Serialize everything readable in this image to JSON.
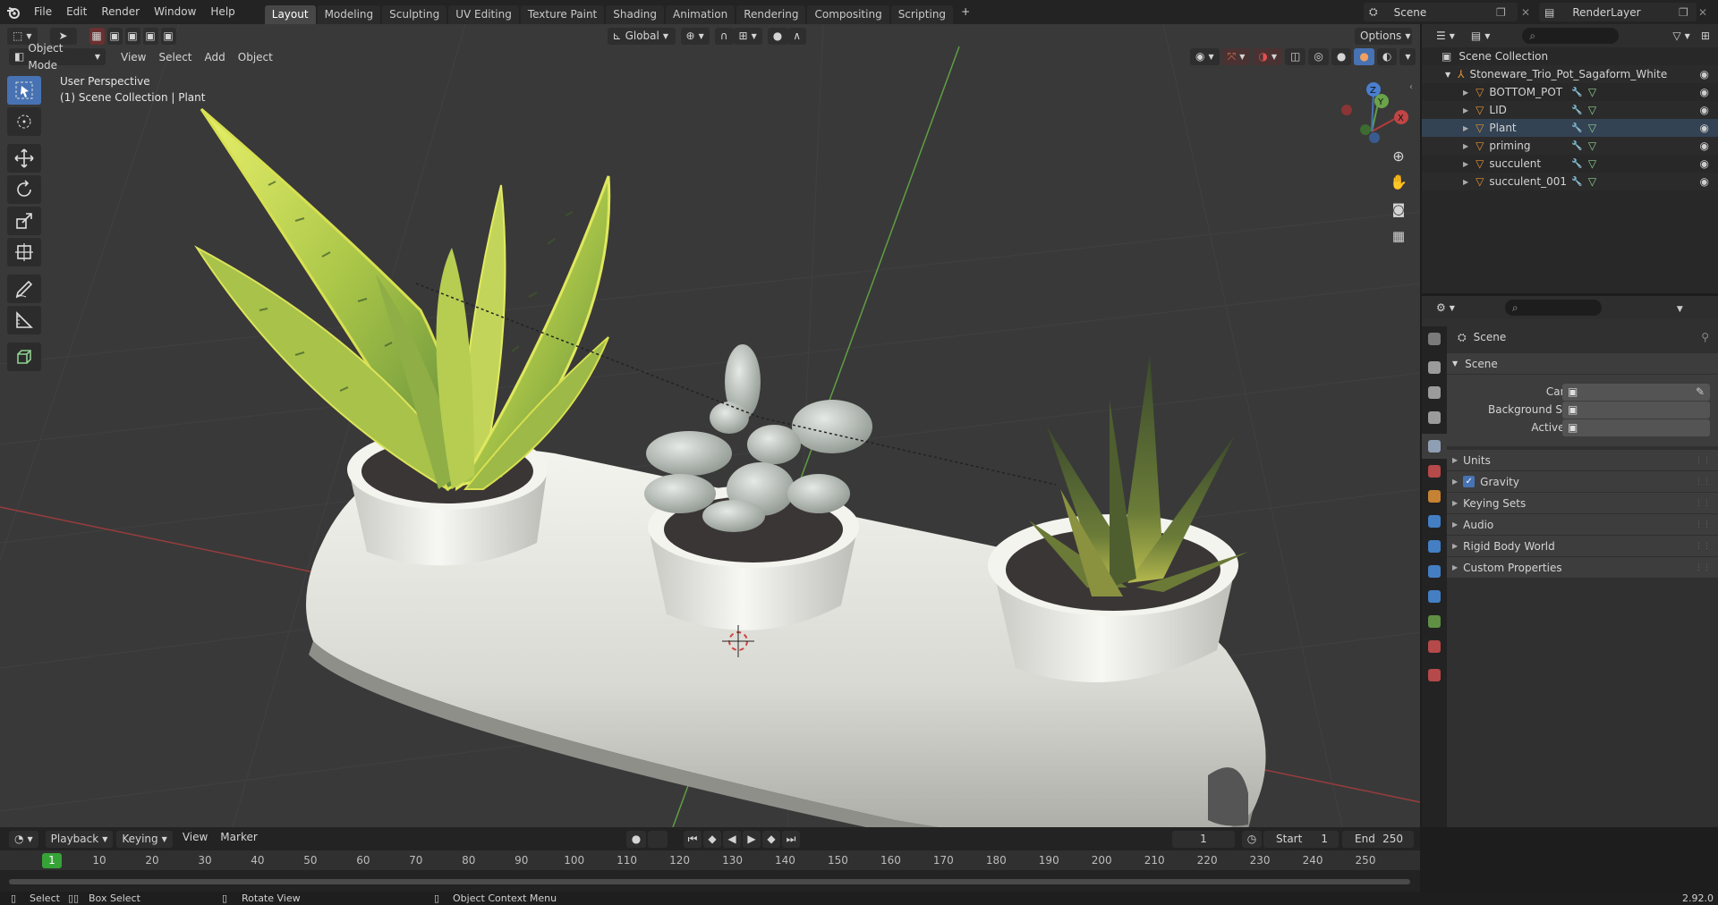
{
  "menu": [
    "File",
    "Edit",
    "Render",
    "Window",
    "Help"
  ],
  "workspaces": [
    "Layout",
    "Modeling",
    "Sculpting",
    "UV Editing",
    "Texture Paint",
    "Shading",
    "Animation",
    "Rendering",
    "Compositing",
    "Scripting"
  ],
  "active_workspace": "Layout",
  "add_workspace": "+",
  "scene_name": "Scene",
  "render_layer": "RenderLayer",
  "viewport": {
    "mode": "Object Mode",
    "menus": [
      "View",
      "Select",
      "Add",
      "Object"
    ],
    "orientation": "Global",
    "options": "Options",
    "perspective_label": "User Perspective",
    "collection_label": "(1) Scene Collection | Plant",
    "gizmo": {
      "x": "X",
      "y": "Y",
      "z": "Z"
    }
  },
  "outliner": {
    "root": "Scene Collection",
    "collection": "Stoneware_Trio_Pot_Sagaform_White",
    "objects": [
      "BOTTOM_POT",
      "LID",
      "Plant",
      "priming",
      "succulent",
      "succulent_001"
    ]
  },
  "properties": {
    "context": "Scene",
    "panel_title": "Scene",
    "fields": [
      {
        "label": "Camera"
      },
      {
        "label": "Background Scene"
      },
      {
        "label": "Active Clip"
      }
    ],
    "subpanels": [
      "Units",
      "Gravity",
      "Keying Sets",
      "Audio",
      "Rigid Body World",
      "Custom Properties"
    ],
    "gravity_enabled": true
  },
  "timeline": {
    "menus": [
      "Playback",
      "Keying",
      "View",
      "Marker"
    ],
    "current_frame": "1",
    "start_label": "Start",
    "start": "1",
    "end_label": "End",
    "end": "250",
    "ticks": [
      "1",
      "10",
      "20",
      "30",
      "40",
      "50",
      "60",
      "70",
      "80",
      "90",
      "100",
      "110",
      "120",
      "130",
      "140",
      "150",
      "160",
      "170",
      "180",
      "190",
      "200",
      "210",
      "220",
      "230",
      "240",
      "250"
    ]
  },
  "status": {
    "select": "Select",
    "box_select": "Box Select",
    "rotate_view": "Rotate View",
    "context_menu": "Object Context Menu",
    "version": "2.92.0"
  },
  "colors": {
    "accent": "#4772b3",
    "frame_current": "#36a336",
    "object_orange": "#e39336",
    "axis_x": "#b53a3a",
    "axis_y": "#6aa34a"
  }
}
